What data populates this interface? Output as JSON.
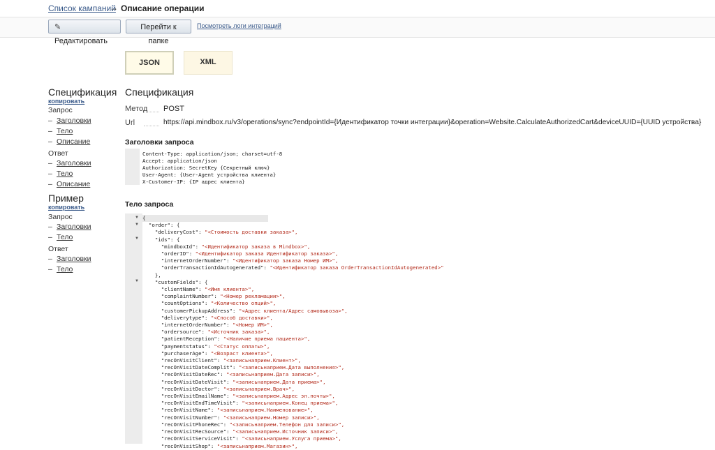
{
  "breadcrumb": {
    "parent": "Список кампаний",
    "arrow": "→",
    "current": "Описание операции"
  },
  "toolbar": {
    "edit_label": "Редактировать",
    "folder_label": "Перейти к папке",
    "logs_link": "Посмотреть логи интеграций"
  },
  "format_tabs": {
    "json": "JSON",
    "xml": "XML"
  },
  "nav": {
    "spec": "Спецификация",
    "spec_copy": "копировать",
    "request": "Запрос",
    "response": "Ответ",
    "headers": "Заголовки",
    "body": "Тело",
    "description": "Описание",
    "example": "Пример",
    "example_copy": "копировать",
    "dash": "–"
  },
  "spec": {
    "title": "Спецификация",
    "method_label": "Метод",
    "method": "POST",
    "url_label": "Url",
    "url": "https://api.mindbox.ru/v3/operations/sync?endpointId={Идентификатор точки интеграции}&operation=Website.CalculateAuthorizedCart&deviceUUID={UUID устройства}",
    "headers_title": "Заголовки запроса",
    "headers": [
      "Content-Type: application/json; charset=utf-8",
      "Accept: application/json",
      "Authorization: SecretKey {Секретный ключ}",
      "User-Agent: {User-Agent устройства клиента}",
      "X-Customer-IP: {IP адрес клиента}"
    ],
    "body_title": "Тело запроса"
  },
  "body_lines": [
    {
      "i": 0,
      "k": "{",
      "v": ""
    },
    {
      "i": 1,
      "k": "\"order\": {",
      "v": ""
    },
    {
      "i": 2,
      "k": "\"deliveryCost\": ",
      "v": "\"<Стоимость доставки заказа>\","
    },
    {
      "i": 2,
      "k": "\"ids\": {",
      "v": ""
    },
    {
      "i": 3,
      "k": "\"mindboxId\": ",
      "v": "\"<Идентификатор заказа в Mindbox>\","
    },
    {
      "i": 3,
      "k": "\"orderID\": ",
      "v": "\"<Идентификатор заказа Идентификатор заказа>\","
    },
    {
      "i": 3,
      "k": "\"internetOrderNumber\": ",
      "v": "\"<Идентификатор заказа Номер ИМ>\","
    },
    {
      "i": 3,
      "k": "\"orderTransactionIdAutogenerated\": ",
      "v": "\"<Идентификатор заказа OrderTransactionIdAutogenerated>\""
    },
    {
      "i": 2,
      "k": "},",
      "v": ""
    },
    {
      "i": 2,
      "k": "\"customFields\": {",
      "v": ""
    },
    {
      "i": 3,
      "k": "\"clientName\": ",
      "v": "\"<Имя клиента>\","
    },
    {
      "i": 3,
      "k": "\"complaintNumber\": ",
      "v": "\"<Номер рекламации>\","
    },
    {
      "i": 3,
      "k": "\"countOptions\": ",
      "v": "\"<Количество опций>\","
    },
    {
      "i": 3,
      "k": "\"customerPickupAddress\": ",
      "v": "\"<Адрес клиента/Адрес самовывоза>\","
    },
    {
      "i": 3,
      "k": "\"deliverytype\": ",
      "v": "\"<Способ доставки>\","
    },
    {
      "i": 3,
      "k": "\"internetOrderNumber\": ",
      "v": "\"<Номер ИМ>\","
    },
    {
      "i": 3,
      "k": "\"ordersource\": ",
      "v": "\"<Источник заказа>\","
    },
    {
      "i": 3,
      "k": "\"patientReception\": ",
      "v": "\"<Наличие приема пациента>\","
    },
    {
      "i": 3,
      "k": "\"paymentstatus\": ",
      "v": "\"<Статус оплаты>\","
    },
    {
      "i": 3,
      "k": "\"purchaserAge\": ",
      "v": "\"<Возраст клиента>\","
    },
    {
      "i": 3,
      "k": "\"recOnVisitClient\": ",
      "v": "\"<записьнаприем.Клиент>\","
    },
    {
      "i": 3,
      "k": "\"recOnVisitDateComplit\": ",
      "v": "\"<записьнаприем.Дата выполнения>\","
    },
    {
      "i": 3,
      "k": "\"recOnVisitDateRec\": ",
      "v": "\"<записьнаприем.Дата записи>\","
    },
    {
      "i": 3,
      "k": "\"recOnVisitDateVisit\": ",
      "v": "\"<записьнаприем.Дата приема>\","
    },
    {
      "i": 3,
      "k": "\"recOnVisitDoctor\": ",
      "v": "\"<записьнаприем.Врач>\","
    },
    {
      "i": 3,
      "k": "\"recOnVisitEmailName\": ",
      "v": "\"<записьнаприем.Адрес эл.почты>\","
    },
    {
      "i": 3,
      "k": "\"recOnVisitEndTimeVisit\": ",
      "v": "\"<записьнаприем.Конец приема>\","
    },
    {
      "i": 3,
      "k": "\"recOnVisitName\": ",
      "v": "\"<записьнаприем.Наименование>\","
    },
    {
      "i": 3,
      "k": "\"recOnVisitNumber\": ",
      "v": "\"<записьнаприем.Номер записи>\","
    },
    {
      "i": 3,
      "k": "\"recOnVisitPhoneRec\": ",
      "v": "\"<записьнаприем.Телефон для записи>\","
    },
    {
      "i": 3,
      "k": "\"recOnVisitRecSource\": ",
      "v": "\"<записьнаприем.Источник записи>\","
    },
    {
      "i": 3,
      "k": "\"recOnVisitServiceVisit\": ",
      "v": "\"<записьнаприем.Услуга приема>\","
    },
    {
      "i": 3,
      "k": "\"recOnVisitShop\": ",
      "v": "\"<записьнаприем.Магазин>\","
    }
  ]
}
